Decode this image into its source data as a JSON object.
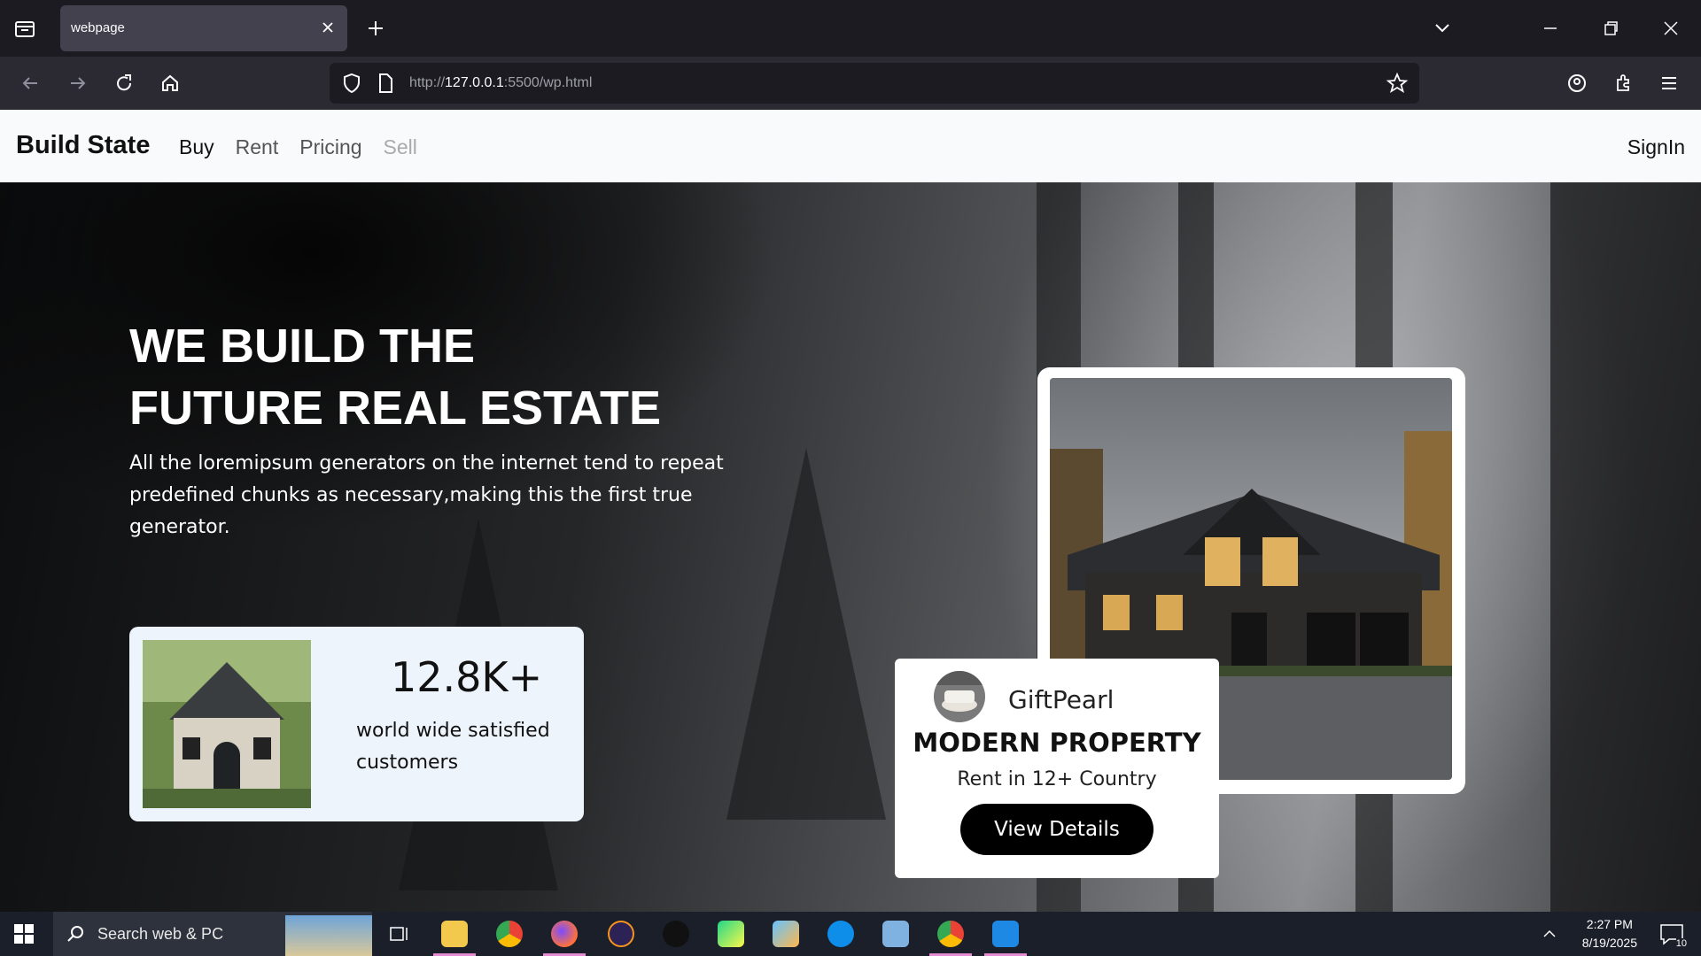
{
  "browser": {
    "tab_title": "webpage",
    "url_prefix": "http://",
    "url_host": "127.0.0.1",
    "url_rest": ":5500/wp.html"
  },
  "site": {
    "brand": "Build State",
    "menu": [
      "Buy",
      "Rent",
      "Pricing",
      "Sell"
    ],
    "signin": "SignIn"
  },
  "hero": {
    "title_line1": "WE BUILD THE",
    "title_line2": "FUTURE REAL ESTATE",
    "subtitle": "All the loremipsum generators on the internet tend to repeat predefined chunks as necessary,making this the first true generator."
  },
  "stats": {
    "number": "12.8K+",
    "label": "world wide satisfied customers"
  },
  "property": {
    "owner": "GiftPearl",
    "title": "MODERN PROPERTY",
    "subtitle": "Rent in 12+ Country",
    "button": "View Details"
  },
  "taskbar": {
    "search_placeholder": "Search web & PC",
    "time": "2:27 PM",
    "date": "8/19/2025",
    "notification_count": "10"
  },
  "colors": {
    "accent_dark": "#000000",
    "card_bg": "#eef4fb",
    "header_bg": "#f9fafb"
  }
}
